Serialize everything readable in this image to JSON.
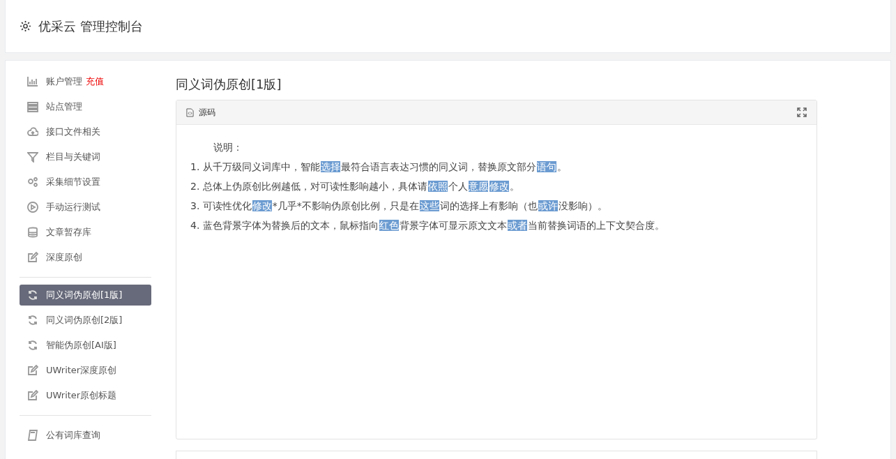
{
  "header": {
    "title": "优采云 管理控制台"
  },
  "sidebar": {
    "groups": [
      {
        "items": [
          {
            "label": "账户管理",
            "badge": "充值",
            "selected": false
          },
          {
            "label": "站点管理",
            "selected": false
          },
          {
            "label": "接口文件相关",
            "selected": false
          },
          {
            "label": "栏目与关键词",
            "selected": false
          },
          {
            "label": "采集细节设置",
            "selected": false
          },
          {
            "label": "手动运行测试",
            "selected": false
          },
          {
            "label": "文章暂存库",
            "selected": false
          },
          {
            "label": "深度原创",
            "selected": false
          }
        ]
      },
      {
        "items": [
          {
            "label": "同义词伪原创[1版]",
            "selected": true
          },
          {
            "label": "同义词伪原创[2版]",
            "selected": false
          },
          {
            "label": "智能伪原创[AI版]",
            "selected": false
          },
          {
            "label": "UWriter深度原创",
            "selected": false
          },
          {
            "label": "UWriter原创标题",
            "selected": false
          }
        ]
      },
      {
        "items": [
          {
            "label": "公有词库查询",
            "selected": false
          }
        ]
      }
    ]
  },
  "page": {
    "title": "同义词伪原创[1版]",
    "panel": {
      "title": "源码",
      "heading": "说明：",
      "lines": [
        [
          {
            "text": "1. 从千万级同义词库中，智能",
            "highlighted": false
          },
          {
            "text": "选择",
            "highlighted": true
          },
          {
            "text": "最符合语言表达习惯的同义词，替换原文部分",
            "highlighted": false
          },
          {
            "text": "语句",
            "highlighted": true
          },
          {
            "text": "。",
            "highlighted": false
          }
        ],
        [
          {
            "text": "2. 总体上伪原创比例越低，对可读性影响越小，具体请",
            "highlighted": false
          },
          {
            "text": "依照",
            "highlighted": true
          },
          {
            "text": "个人",
            "highlighted": false
          },
          {
            "text": "意愿",
            "highlighted": true
          },
          {
            "text": "修改",
            "highlighted": true
          },
          {
            "text": "。",
            "highlighted": false
          }
        ],
        [
          {
            "text": "3. 可读性优化",
            "highlighted": false
          },
          {
            "text": "修改",
            "highlighted": true
          },
          {
            "text": "*几乎*不影响伪原创比例，只是在",
            "highlighted": false
          },
          {
            "text": "这些",
            "highlighted": true
          },
          {
            "text": "词的选择上有影响（也",
            "highlighted": false
          },
          {
            "text": "或许",
            "highlighted": true
          },
          {
            "text": "没影响）。",
            "highlighted": false
          }
        ],
        [
          {
            "text": "4. 蓝色背景字体为替换后的文本，鼠标指向",
            "highlighted": false
          },
          {
            "text": "红色",
            "highlighted": true
          },
          {
            "text": "背景字体可显示原文文本",
            "highlighted": false
          },
          {
            "text": "或者",
            "highlighted": true
          },
          {
            "text": "当前替换词语的上下文契合度。",
            "highlighted": false
          }
        ]
      ]
    }
  }
}
